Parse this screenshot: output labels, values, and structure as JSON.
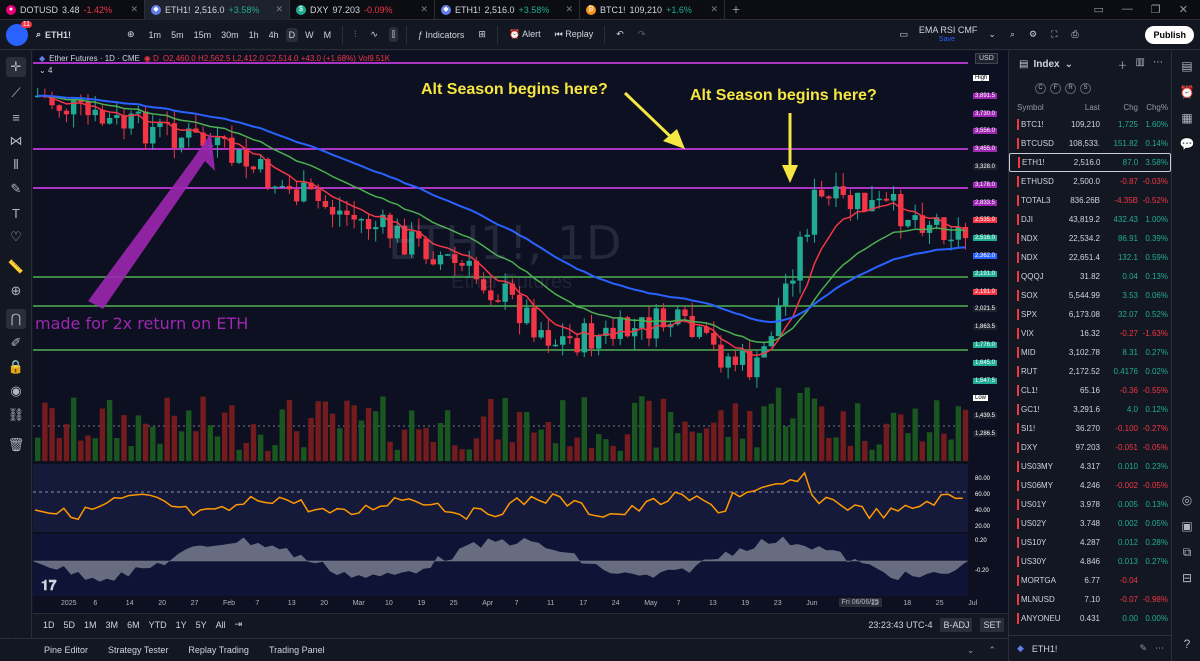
{
  "tabs": [
    {
      "symbol": "DOTUSD",
      "price": "3.48",
      "change": "-1.42%",
      "dir": "neg",
      "color": "#e6007a",
      "glyph": "●"
    },
    {
      "symbol": "ETH1!",
      "price": "2,516.0",
      "change": "+3.58%",
      "dir": "pos",
      "color": "#627eea",
      "glyph": "◆"
    },
    {
      "symbol": "DXY",
      "price": "97.203",
      "change": "-0.09%",
      "dir": "neg",
      "color": "#22ab94",
      "glyph": "$"
    },
    {
      "symbol": "ETH1!",
      "price": "2,516.0",
      "change": "+3.58%",
      "dir": "pos",
      "color": "#627eea",
      "glyph": "◆"
    },
    {
      "symbol": "BTC1!",
      "price": "109,210",
      "change": "+1.6%",
      "dir": "pos",
      "color": "#f7931a",
      "glyph": "₿"
    }
  ],
  "toolbar": {
    "badge": "11",
    "symbol": "ETH1!",
    "intervals": [
      "1m",
      "5m",
      "15m",
      "30m",
      "1h",
      "4h",
      "D",
      "W",
      "M"
    ],
    "selected_interval": "D",
    "indicators_label": "Indicators",
    "alert_label": "Alert",
    "replay_label": "Replay",
    "layout_name": "EMA RSI CMF",
    "layout_sub": "Save",
    "publish_label": "Publish"
  },
  "chart": {
    "legend_title": "Ether Futures · 1D · CME",
    "legend_ohlc": "O2,460.0 H2,562.5 L2,412.0 C2,514.0 +43.0 (+1.68%) Vol9.51K",
    "legend_count": "4",
    "watermark_symbol": "ETH1!, 1D",
    "watermark_name": "Ether Futures",
    "annotation_1": "Alt Season begins here?",
    "annotation_2": "Alt Season begins here?",
    "annotation_3": "made for 2x return on ETH",
    "currency": "USD",
    "x_labels": [
      "2025",
      "6",
      "14",
      "20",
      "27",
      "Feb",
      "7",
      "13",
      "20",
      "Mar",
      "10",
      "19",
      "25",
      "Apr",
      "7",
      "11",
      "17",
      "24",
      "May",
      "7",
      "13",
      "19",
      "23",
      "Jun",
      "Fri 06/06/25",
      "12",
      "18",
      "25",
      "Jul"
    ],
    "y_labels": [
      {
        "text": "High",
        "bg": "#ffffff",
        "fg": "#000000"
      },
      {
        "text": "3,891.5",
        "bg": "#9c27b0",
        "fg": "#ffffff"
      },
      {
        "text": "3,730.0",
        "bg": "#9c27b0",
        "fg": "#ffffff"
      },
      {
        "text": "3,556.0",
        "bg": "#9c27b0",
        "fg": "#ffffff"
      },
      {
        "text": "3,455.0",
        "bg": "#9c27b0",
        "fg": "#ffffff"
      },
      {
        "text": "3,328.0",
        "bg": "#1e222d",
        "fg": "#ffffff"
      },
      {
        "text": "3,178.0",
        "bg": "#9c27b0",
        "fg": "#ffffff"
      },
      {
        "text": "2,833.5",
        "bg": "#9c27b0",
        "fg": "#ffffff"
      },
      {
        "text": "2,535.0",
        "bg": "#f23645",
        "fg": "#ffffff"
      },
      {
        "text": "2,516.0",
        "bg": "#22ab94",
        "fg": "#ffffff"
      },
      {
        "text": "2,362.0",
        "bg": "#2962ff",
        "fg": "#ffffff"
      },
      {
        "text": "2,191.0",
        "bg": "#22ab94",
        "fg": "#ffffff"
      },
      {
        "text": "2,191.0",
        "bg": "#f23645",
        "fg": "#ffffff"
      },
      {
        "text": "2,021.5",
        "bg": "#1e222d",
        "fg": "#ffffff"
      },
      {
        "text": "1,863.5",
        "bg": "#1e222d",
        "fg": "#ffffff"
      },
      {
        "text": "1,776.0",
        "bg": "#22ab94",
        "fg": "#ffffff"
      },
      {
        "text": "1,645.0",
        "bg": "#22ab94",
        "fg": "#ffffff"
      },
      {
        "text": "1,547.5",
        "bg": "#22ab94",
        "fg": "#ffffff"
      },
      {
        "text": "Low",
        "bg": "#ffffff",
        "fg": "#000000"
      },
      {
        "text": "1,439.5",
        "bg": "#1e222d",
        "fg": "#ffffff"
      },
      {
        "text": "1,286.5",
        "bg": "#1e222d",
        "fg": "#ffffff"
      }
    ],
    "rsi_labels": [
      "80.00",
      "60.00",
      "40.00",
      "20.00"
    ],
    "cmf_labels": [
      "0.20",
      "-0.20"
    ]
  },
  "timebar": {
    "ranges": [
      "1D",
      "5D",
      "1M",
      "3M",
      "6M",
      "YTD",
      "1Y",
      "5Y",
      "All"
    ],
    "clock": "23:23:43 UTC-4",
    "badj": "B-ADJ",
    "set": "SET"
  },
  "bottom_tabs": [
    "Pine Editor",
    "Strategy Tester",
    "Replay Trading",
    "Trading Panel"
  ],
  "watchlist": {
    "title": "Index",
    "section_badges": [
      "C",
      "F",
      "R",
      "S"
    ],
    "columns": [
      "Symbol",
      "Last",
      "Chg",
      "Chg%"
    ],
    "rows": [
      {
        "sym": "BTC1!",
        "last": "109,210",
        "chg": "1,725",
        "pct": "1.60%",
        "dir": "pos"
      },
      {
        "sym": "BTCUSD",
        "last": "108,533.",
        "chg": "151.82",
        "pct": "0.14%",
        "dir": "pos"
      },
      {
        "sym": "ETH1!",
        "last": "2,516.0",
        "chg": "87.0",
        "pct": "3.58%",
        "dir": "pos"
      },
      {
        "sym": "ETHUSD",
        "last": "2,500.0",
        "chg": "-0.87",
        "pct": "-0.03%",
        "dir": "neg"
      },
      {
        "sym": "TOTAL3",
        "last": "836.26B",
        "chg": "-4.35B",
        "pct": "-0.52%",
        "dir": "neg"
      },
      {
        "sym": "DJI",
        "last": "43,819.2",
        "chg": "432.43",
        "pct": "1.00%",
        "dir": "pos"
      },
      {
        "sym": "NDX",
        "last": "22,534.2",
        "chg": "86.91",
        "pct": "0.39%",
        "dir": "pos"
      },
      {
        "sym": "NDX",
        "last": "22,651.4",
        "chg": "132.1",
        "pct": "0.59%",
        "dir": "pos"
      },
      {
        "sym": "QQQJ",
        "last": "31.82",
        "chg": "0.04",
        "pct": "0.13%",
        "dir": "pos"
      },
      {
        "sym": "SOX",
        "last": "5,544.99",
        "chg": "3.53",
        "pct": "0.06%",
        "dir": "pos"
      },
      {
        "sym": "SPX",
        "last": "6,173.08",
        "chg": "32.07",
        "pct": "0.52%",
        "dir": "pos"
      },
      {
        "sym": "VIX",
        "last": "16.32",
        "chg": "-0.27",
        "pct": "-1.63%",
        "dir": "neg"
      },
      {
        "sym": "MID",
        "last": "3,102.78",
        "chg": "8.31",
        "pct": "0.27%",
        "dir": "pos"
      },
      {
        "sym": "RUT",
        "last": "2,172.52",
        "chg": "0.4176",
        "pct": "0.02%",
        "dir": "pos"
      },
      {
        "sym": "CL1!",
        "last": "65.16",
        "chg": "-0.36",
        "pct": "-0.55%",
        "dir": "neg"
      },
      {
        "sym": "GC1!",
        "last": "3,291.6",
        "chg": "4.0",
        "pct": "0.12%",
        "dir": "pos"
      },
      {
        "sym": "SI1!",
        "last": "36.270",
        "chg": "-0.100",
        "pct": "-0.27%",
        "dir": "neg"
      },
      {
        "sym": "DXY",
        "last": "97.203",
        "chg": "-0.051",
        "pct": "-0.05%",
        "dir": "neg"
      },
      {
        "sym": "US03MY",
        "last": "4.317",
        "chg": "0.010",
        "pct": "0.23%",
        "dir": "pos"
      },
      {
        "sym": "US06MY",
        "last": "4.246",
        "chg": "-0.002",
        "pct": "-0.05%",
        "dir": "neg"
      },
      {
        "sym": "US01Y",
        "last": "3.978",
        "chg": "0.005",
        "pct": "0.13%",
        "dir": "pos"
      },
      {
        "sym": "US02Y",
        "last": "3.748",
        "chg": "0.002",
        "pct": "0.05%",
        "dir": "pos"
      },
      {
        "sym": "US10Y",
        "last": "4.287",
        "chg": "0.012",
        "pct": "0.28%",
        "dir": "pos"
      },
      {
        "sym": "US30Y",
        "last": "4.846",
        "chg": "0.013",
        "pct": "0.27%",
        "dir": "pos"
      },
      {
        "sym": "MORTGA",
        "last": "6.77",
        "chg": "-0.04",
        "pct": "",
        "dir": "neg"
      },
      {
        "sym": "MLNUSD",
        "last": "7.10",
        "chg": "-0.07",
        "pct": "-0.98%",
        "dir": "neg"
      },
      {
        "sym": "ANYONEU",
        "last": "0.431",
        "chg": "0.00",
        "pct": "0.00%",
        "dir": "pos"
      }
    ],
    "footer_symbol": "ETH1!"
  },
  "colors": {
    "up": "#22ab94",
    "down": "#f23645",
    "ema_red": "#f23645",
    "ema_green": "#4caf50",
    "ema_blue": "#2962ff",
    "annotation": "#f5e642",
    "arrow": "#9c27b0",
    "rsi": "#ff9800"
  }
}
